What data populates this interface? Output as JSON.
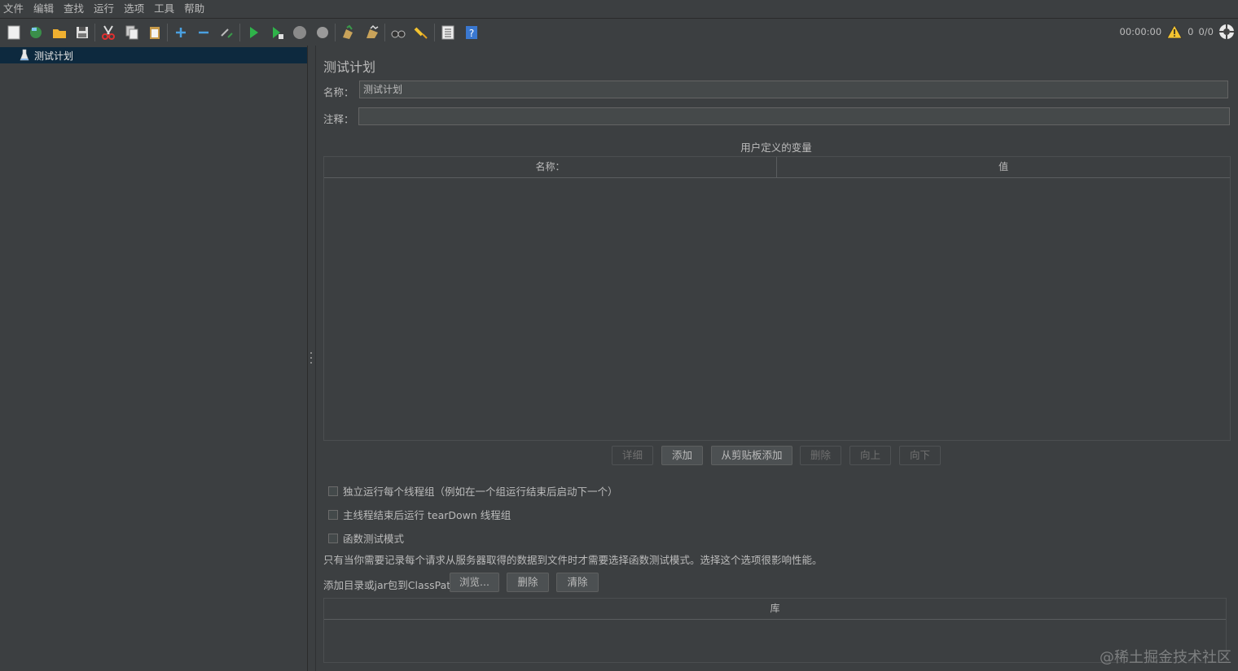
{
  "menu": [
    "文件",
    "编辑",
    "查找",
    "运行",
    "选项",
    "工具",
    "帮助"
  ],
  "toolbar_icons": [
    "new-icon",
    "templates-icon",
    "open-icon",
    "save-icon",
    "cut-icon",
    "copy-icon",
    "paste-icon",
    "expand-icon",
    "collapse-icon",
    "toggle-icon",
    "start-icon",
    "start-no-pause-icon",
    "stop-icon",
    "shutdown-icon",
    "clear-icon",
    "clear-all-icon",
    "search-icon",
    "reset-search-icon",
    "function-helper-icon",
    "help-icon"
  ],
  "status": {
    "time": "00:00:00",
    "warnings": "0",
    "threads": "0/0"
  },
  "tree": {
    "root_label": "测试计划"
  },
  "testplan": {
    "title": "测试计划",
    "name_label": "名称：",
    "name_value": "测试计划",
    "comment_label": "注释：",
    "comment_value": "",
    "vars_title": "用户定义的变量",
    "col_name": "名称：",
    "col_value": "值"
  },
  "buttons": {
    "detail": "详细",
    "add": "添加",
    "add_clipboard": "从剪贴板添加",
    "delete": "删除",
    "up": "向上",
    "down": "向下"
  },
  "options": {
    "serialize": "独立运行每个线程组（例如在一个组运行结束后启动下一个）",
    "teardown": "主线程结束后运行 tearDown 线程组",
    "functional": "函数测试模式",
    "info": "只有当你需要记录每个请求从服务器取得的数据到文件时才需要选择函数测试模式。选择这个选项很影响性能。"
  },
  "classpath": {
    "label": "添加目录或jar包到ClassPath",
    "browse": "浏览...",
    "delete": "删除",
    "clear": "清除",
    "lib_header": "库"
  },
  "watermark": "@稀土掘金技术社区",
  "colors": {
    "background": "#3c3f41",
    "selection": "#0d293e",
    "text": "#bbbbbb"
  }
}
